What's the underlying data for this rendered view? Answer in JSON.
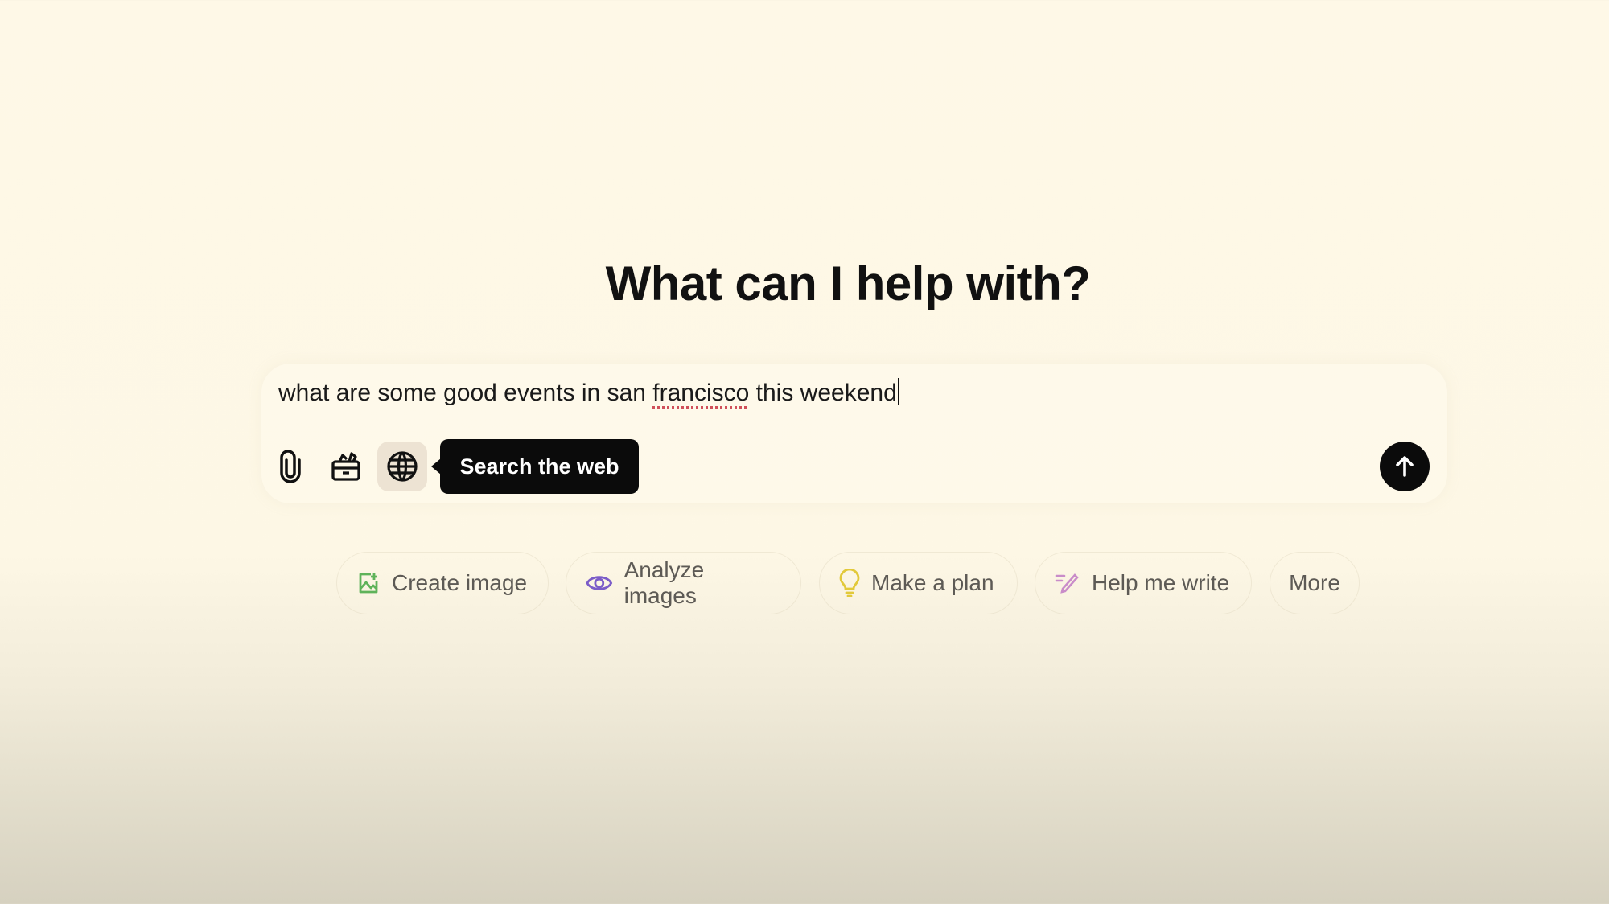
{
  "heading": "What can I help with?",
  "composer": {
    "text_before": "what are some good events in san ",
    "text_misspelled": "francisco",
    "text_after": " this weekend",
    "tools": [
      {
        "icon": "paperclip-icon",
        "label": "Attach files"
      },
      {
        "icon": "toolbox-icon",
        "label": "Tools"
      },
      {
        "icon": "globe-icon",
        "label": "Search the web",
        "active": true
      }
    ],
    "tooltip": "Search the web",
    "send_icon": "arrow-up-icon"
  },
  "suggestions": [
    {
      "label": "Create image",
      "icon": "image-icon",
      "color": "#5fb35a"
    },
    {
      "label": "Analyze images",
      "icon": "eye-icon",
      "color": "#7b5cc8"
    },
    {
      "label": "Make a plan",
      "icon": "lightbulb-icon",
      "color": "#e2c93a"
    },
    {
      "label": "Help me write",
      "icon": "pen-icon",
      "color": "#c98cc9"
    },
    {
      "label": "More"
    }
  ]
}
